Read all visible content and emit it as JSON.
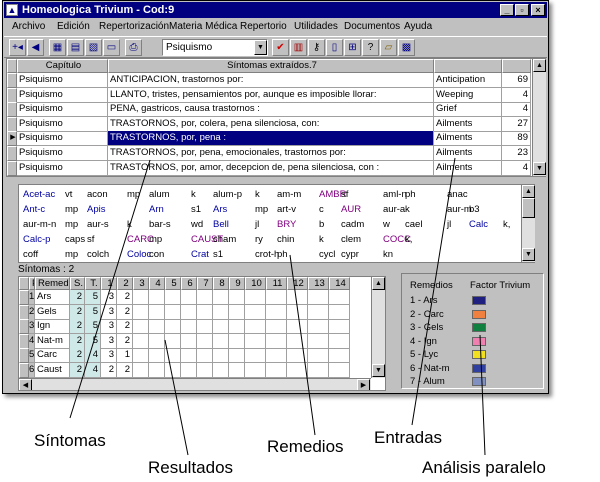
{
  "window": {
    "title": "Homeologica Trivium - Cod:9"
  },
  "menu": [
    "Archivo",
    "Edición",
    "Repertorización",
    "Materia Médica",
    "Repertorio",
    "Utilidades",
    "Documentos",
    "Ayuda"
  ],
  "toolbar": {
    "combo_value": "Psiquismo"
  },
  "symptoms_table": {
    "headers": [
      "Capítulo",
      "Síntomas extraídos.7"
    ],
    "rows": [
      {
        "chapter": "Psiquismo",
        "symptom": "ANTICIPACION,      trastornos por:",
        "entry": "Anticipation",
        "count": "69"
      },
      {
        "chapter": "Psiquismo",
        "symptom": "LLANTO, tristes, pensamientos por, aunque es imposible llorar:",
        "entry": "Weeping",
        "count": "4"
      },
      {
        "chapter": "Psiquismo",
        "symptom": "PENA, gastricos, causa trastornos :",
        "entry": "Grief",
        "count": "4"
      },
      {
        "chapter": "Psiquismo",
        "symptom": "TRASTORNOS, por, colera, pena silenciosa, con:",
        "entry": "Ailments",
        "count": "27"
      },
      {
        "chapter": "Psiquismo",
        "symptom": "TRASTORNOS, por, pena :",
        "entry": "Ailments",
        "count": "89"
      },
      {
        "chapter": "Psiquismo",
        "symptom": "TRASTORNOS, por, pena, emocionales, trastornos por:",
        "entry": "Ailments",
        "count": "23"
      },
      {
        "chapter": "Psiquismo",
        "symptom": "TRASTORNOS, por, amor, decepcion de, pena silenciosa, con :",
        "entry": "Ailments",
        "count": "4"
      }
    ]
  },
  "remedies": [
    [
      [
        "Acet-ac",
        "blue"
      ],
      [
        "vt",
        ""
      ],
      [
        "acon",
        ""
      ],
      [
        "mp",
        ""
      ],
      [
        "alum",
        ""
      ],
      [
        "k",
        ""
      ],
      [
        "alum-p",
        ""
      ],
      [
        "k",
        ""
      ],
      [
        "am-m",
        ""
      ],
      [
        "AMBR",
        "purple"
      ],
      [
        "sf",
        ""
      ],
      [
        "aml-n",
        ""
      ],
      [
        "ph",
        ""
      ],
      [
        "anac",
        ""
      ]
    ],
    [
      [
        "Ant-c",
        "blue"
      ],
      [
        "mp",
        ""
      ],
      [
        "Apis",
        "blue"
      ],
      [
        "",
        ""
      ],
      [
        "Arn",
        "blue"
      ],
      [
        "s1",
        ""
      ],
      [
        "Ars",
        "blue"
      ],
      [
        "mp",
        ""
      ],
      [
        "art-v",
        ""
      ],
      [
        "c",
        ""
      ],
      [
        "AUR",
        "purple"
      ],
      [
        "aur-a",
        ""
      ],
      [
        "k",
        ""
      ],
      [
        "aur-m",
        ""
      ],
      [
        "b3",
        ""
      ]
    ],
    [
      [
        "aur-m-n",
        ""
      ],
      [
        "mp",
        ""
      ],
      [
        "aur-s",
        ""
      ],
      [
        "k",
        ""
      ],
      [
        "bar-s",
        ""
      ],
      [
        "wd",
        ""
      ],
      [
        "Bell",
        "blue"
      ],
      [
        "jl",
        ""
      ],
      [
        "BRY",
        "purple"
      ],
      [
        "b",
        ""
      ],
      [
        "cadm",
        ""
      ],
      [
        "w",
        ""
      ],
      [
        "cael",
        ""
      ],
      [
        "jl",
        ""
      ],
      [
        "Calc",
        "blue"
      ],
      [
        "k,",
        ""
      ]
    ],
    [
      [
        "Calc-p",
        "blue"
      ],
      [
        "caps",
        ""
      ],
      [
        "sf",
        ""
      ],
      [
        "CARC",
        "purple"
      ],
      [
        "mp",
        ""
      ],
      [
        "CAUST",
        "purple"
      ],
      [
        "cham",
        ""
      ],
      [
        "ry",
        ""
      ],
      [
        "chin",
        ""
      ],
      [
        "k",
        ""
      ],
      [
        "clem",
        ""
      ],
      [
        "COCC",
        "purple"
      ],
      [
        "k,",
        ""
      ]
    ],
    [
      [
        "coff",
        ""
      ],
      [
        "mp",
        ""
      ],
      [
        "colch",
        ""
      ],
      [
        "Coloc",
        "blue"
      ],
      [
        "con",
        ""
      ],
      [
        "Crat",
        "blue"
      ],
      [
        "s1",
        ""
      ],
      [
        "crot-h",
        ""
      ],
      [
        "ph",
        ""
      ],
      [
        "cycl",
        ""
      ],
      [
        "cypr",
        ""
      ],
      [
        "kn",
        ""
      ]
    ]
  ],
  "symptom_count": "Síntomas : 2",
  "results": {
    "headers": [
      "P.",
      "Remedio",
      "S.",
      "T.",
      "1",
      "2",
      "3",
      "4",
      "5",
      "6",
      "7",
      "8",
      "9",
      "10",
      "11",
      "12",
      "13",
      "14"
    ],
    "rows": [
      {
        "p": "1",
        "rem": "Ars",
        "s": "2",
        "t": "5",
        "c1": "3",
        "c2": "2"
      },
      {
        "p": "2",
        "rem": "Gels",
        "s": "2",
        "t": "5",
        "c1": "3",
        "c2": "2"
      },
      {
        "p": "3",
        "rem": "Ign",
        "s": "2",
        "t": "5",
        "c1": "3",
        "c2": "2"
      },
      {
        "p": "4",
        "rem": "Nat-m",
        "s": "2",
        "t": "5",
        "c1": "3",
        "c2": "2"
      },
      {
        "p": "5",
        "rem": "Carc",
        "s": "2",
        "t": "4",
        "c1": "3",
        "c2": "1"
      },
      {
        "p": "6",
        "rem": "Caust",
        "s": "2",
        "t": "4",
        "c1": "2",
        "c2": "2"
      }
    ]
  },
  "parallel": {
    "header_remedies": "Remedios",
    "header_factor": "Factor Trivium",
    "items": [
      {
        "label": "1 - Ars",
        "color": "#202080"
      },
      {
        "label": "2 - Carc",
        "color": "#f08040"
      },
      {
        "label": "3 - Gels",
        "color": "#108040"
      },
      {
        "label": "4 - Ign",
        "color": "#f080b0"
      },
      {
        "label": "5 - Lyc",
        "color": "#f0e020"
      },
      {
        "label": "6 - Nat-m",
        "color": "#3040a0"
      },
      {
        "label": "7 - Alum",
        "color": "#8090c0"
      }
    ]
  },
  "annotations": {
    "sintomas": "Síntomas",
    "resultados": "Resultados",
    "remedios": "Remedios",
    "entradas": "Entradas",
    "analisis": "Análisis paralelo"
  }
}
